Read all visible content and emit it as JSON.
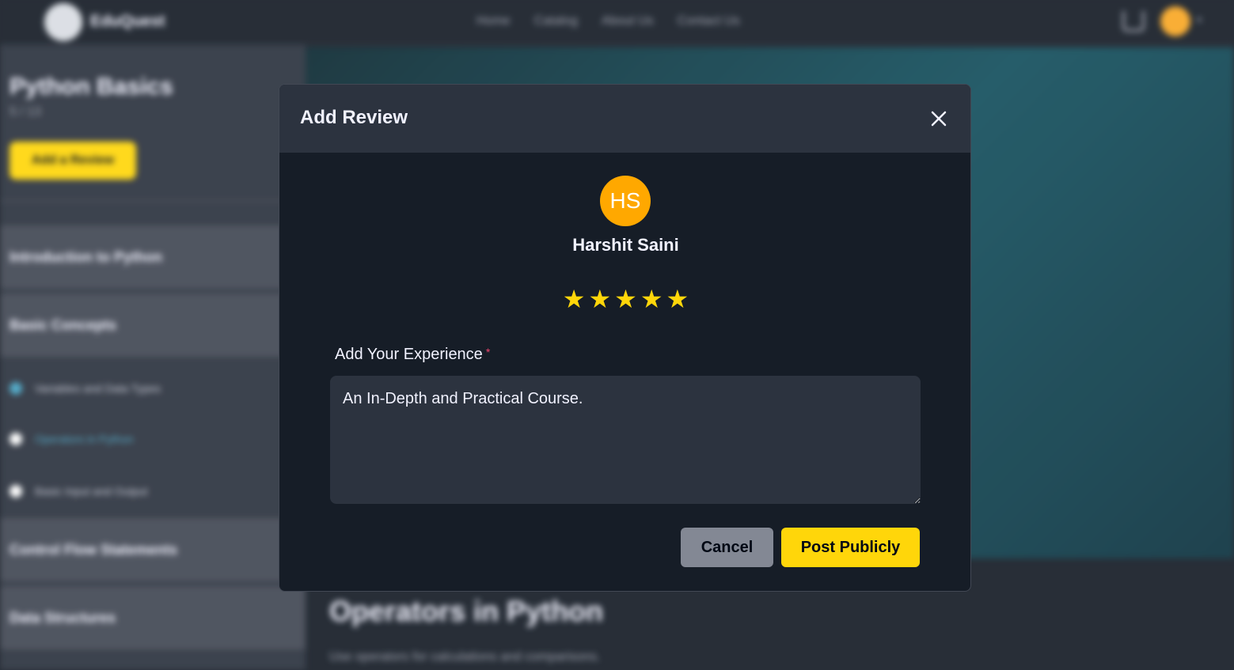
{
  "background": {
    "navbar": {
      "logo_text": "EduQuest",
      "links": [
        "Home",
        "Catalog",
        "About Us",
        "Contact Us"
      ],
      "avatar_color": "#f9a825"
    },
    "sidebar": {
      "course_title": "Python Basics",
      "progress": "5 / 13",
      "add_review_label": "Add a Review",
      "sections": [
        "Introduction to Python",
        "Basic Concepts",
        "Control Flow Statements",
        "Data Structures"
      ],
      "subsections": [
        "Variables and Data Types",
        "Operators in Python",
        "Basic Input and Output"
      ],
      "active_subsection": "Operators in Python"
    },
    "lesson": {
      "title": "Operators in Python",
      "description": "Use operators for calculations and comparisons."
    }
  },
  "modal": {
    "title": "Add Review",
    "user": {
      "initials": "HS",
      "name": "Harshit Saini",
      "avatar_color": "#ffa800"
    },
    "rating": 5,
    "max_rating": 5,
    "star_color": "#ffd60a",
    "field_label": "Add Your Experience",
    "required_mark": "*",
    "review_text": "An In-Depth and Practical Course.",
    "cancel_label": "Cancel",
    "post_label": "Post Publicly"
  }
}
